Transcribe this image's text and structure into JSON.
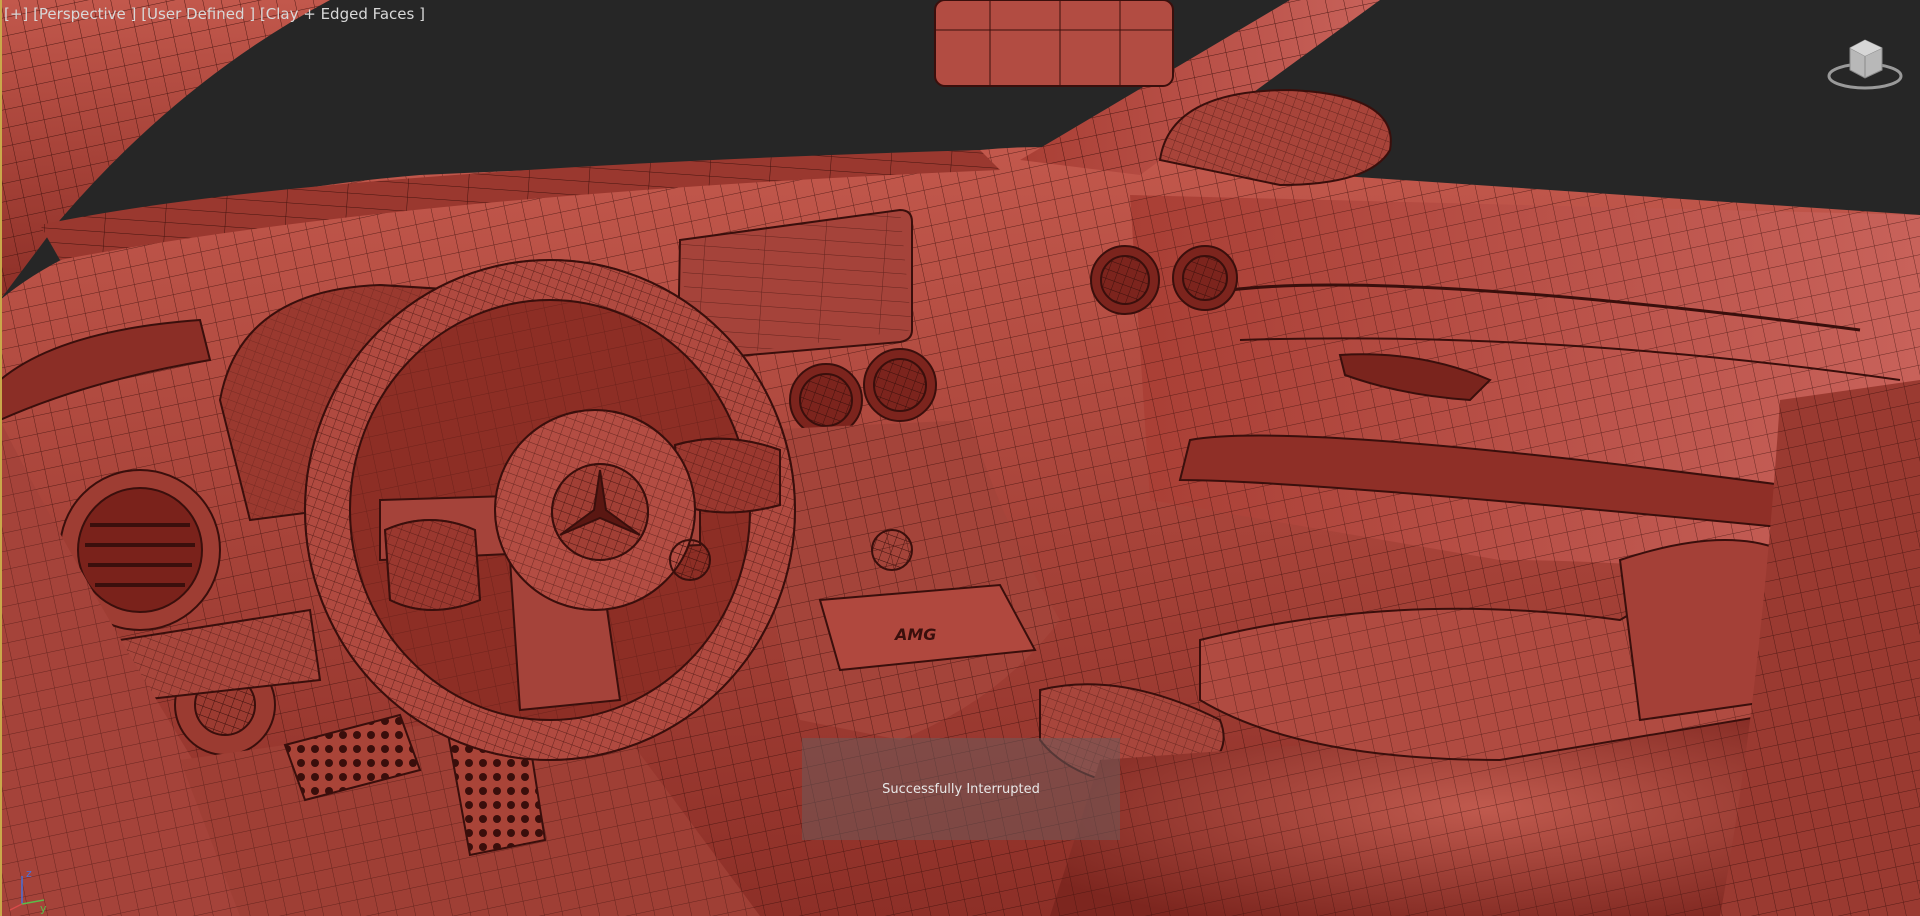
{
  "viewport": {
    "label_parts": [
      "[+]",
      "[Perspective ]",
      "[User Defined ]",
      "[Clay + Edged Faces ]"
    ],
    "toast_message": "Successfully Interrupted",
    "background_color": "#262626",
    "model_color": "#b14a40",
    "wire_color": "#3a0f0c"
  },
  "axis_tripod": {
    "z_label": "z",
    "y_label": "y"
  },
  "viewcube": {
    "name": "ViewCube"
  }
}
